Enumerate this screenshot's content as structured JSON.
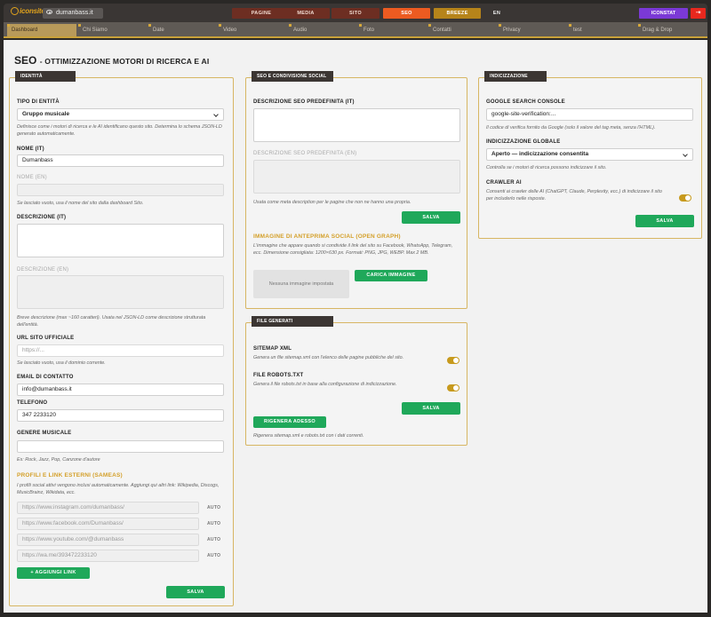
{
  "topbar": {
    "logo": "iconsite",
    "site": "dumanbass.it",
    "nav": [
      "PAGINE",
      "MEDIA",
      "SITO",
      "SEO",
      "BREEZE",
      "EN"
    ],
    "iconstat": "ICONSTAT",
    "logout_icon": "logout-icon"
  },
  "subtabs": [
    "Dashboard",
    "Chi Siamo",
    "Date",
    "Video",
    "Audio",
    "Foto",
    "Contatti",
    "Privacy",
    "test",
    "Drag & Drop"
  ],
  "page": {
    "title": "SEO",
    "subtitle": "- OTTIMIZZAZIONE MOTORI DI RICERCA E AI"
  },
  "identity": {
    "header": "IDENTITÀ",
    "entity_type_label": "TIPO DI ENTITÀ",
    "entity_type_value": "Gruppo musicale",
    "entity_hint": "Definisce come i motori di ricerca e le AI identificano questo sito. Determina lo schema JSON-LD generato automaticamente.",
    "name_it_label": "NOME (IT)",
    "name_it_value": "Dumanbass",
    "name_en_label": "NOME (EN)",
    "name_hint": "Se lasciato vuoto, usa il nome del sito dalla dashboard Sito.",
    "desc_it_label": "DESCRIZIONE (IT)",
    "desc_en_label": "DESCRIZIONE (EN)",
    "desc_hint": "Breve descrizione (max ~160 caratteri). Usata nel JSON-LD come descrizione strutturata dell'entità.",
    "url_label": "URL SITO UFFICIALE",
    "url_placeholder": "https://...",
    "url_hint": "Se lasciato vuoto, usa il dominio corrente.",
    "email_label": "EMAIL DI CONTATTO",
    "email_value": "info@dumanbass.it",
    "phone_label": "TELEFONO",
    "phone_value": "347 2233120",
    "genre_label": "GENERE MUSICALE",
    "genre_hint": "Es: Rock, Jazz, Pop, Canzone d'autore",
    "profiles_title": "PROFILI E LINK ESTERNI (SAMEAS)",
    "profiles_hint": "I profili social attivi vengono inclusi automaticamente. Aggiungi qui altri link: Wikipedia, Discogs, MusicBrainz, Wikidata, ecc.",
    "links": [
      "https://www.instagram.com/dumanbass/",
      "https://www.facebook.com/Dumanbass/",
      "https://www.youtube.com/@dumanbass",
      "https://wa.me/393472233120"
    ],
    "auto_label": "AUTO",
    "add_link": "+ AGGIUNGI LINK",
    "save": "SALVA"
  },
  "social": {
    "header": "SEO E CONDIVISIONE SOCIAL",
    "desc_it_label": "DESCRIZIONE SEO PREDEFINITA (IT)",
    "desc_en_label": "DESCRIZIONE SEO PREDEFINITA (EN)",
    "desc_hint": "Usata come meta description per le pagine che non ne hanno una propria.",
    "save": "SALVA",
    "og_title": "IMMAGINE DI ANTEPRIMA SOCIAL (OPEN GRAPH)",
    "og_hint": "L'immagine che appare quando si condivide il link del sito su Facebook, WhatsApp, Telegram, ecc. Dimensione consigliata: 1200×630 px. Formati: PNG, JPG, WEBP. Max 2 MB.",
    "og_placeholder": "Nessuna immagine impostata",
    "og_upload": "CARICA IMMAGINE"
  },
  "files": {
    "header": "FILE GENERATI",
    "sitemap_label": "SITEMAP XML",
    "sitemap_hint": "Genera un file sitemap.xml con l'elenco delle pagine pubbliche del sito.",
    "robots_label": "FILE ROBOTS.TXT",
    "robots_hint": "Genera il file robots.txt in base alla configurazione di indicizzazione.",
    "save": "SALVA",
    "regen": "RIGENERA ADESSO",
    "regen_hint": "Rigenera sitemap.xml e robots.txt con i dati correnti."
  },
  "indexing": {
    "header": "INDICIZZAZIONE",
    "gsc_label": "GOOGLE SEARCH CONSOLE",
    "gsc_value": "google-site-verification:...",
    "gsc_hint": "Il codice di verifica fornito da Google (solo il valore del tag meta, senza l'HTML).",
    "global_label": "INDICIZZAZIONE GLOBALE",
    "global_value": "Aperto — indicizzazione consentita",
    "global_hint": "Controlla se i motori di ricerca possono indicizzare il sito.",
    "crawler_label": "CRAWLER AI",
    "crawler_hint": "Consenti ai crawler delle AI (ChatGPT, Claude, Perplexity, ecc.) di indicizzare il sito per includerlo nelle risposte.",
    "save": "SALVA"
  }
}
